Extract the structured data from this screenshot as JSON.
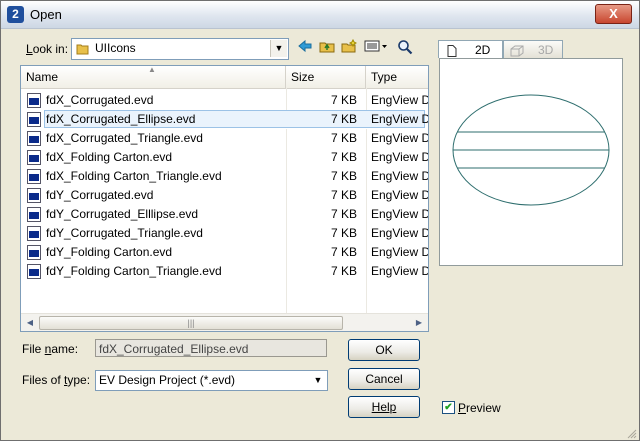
{
  "window": {
    "title": "Open",
    "close_label": "X"
  },
  "lookin": {
    "label": "Look in:",
    "value": "UIIcons"
  },
  "columns": {
    "name": "Name",
    "size": "Size",
    "type": "Type"
  },
  "files": [
    {
      "name": "fdX_Corrugated.evd",
      "size": "7 KB",
      "type": "EngView D",
      "selected": false
    },
    {
      "name": "fdX_Corrugated_Ellipse.evd",
      "size": "7 KB",
      "type": "EngView D",
      "selected": true
    },
    {
      "name": "fdX_Corrugated_Triangle.evd",
      "size": "7 KB",
      "type": "EngView D",
      "selected": false
    },
    {
      "name": "fdX_Folding Carton.evd",
      "size": "7 KB",
      "type": "EngView D",
      "selected": false
    },
    {
      "name": "fdX_Folding Carton_Triangle.evd",
      "size": "7 KB",
      "type": "EngView D",
      "selected": false
    },
    {
      "name": "fdY_Corrugated.evd",
      "size": "7 KB",
      "type": "EngView D",
      "selected": false
    },
    {
      "name": "fdY_Corrugated_Elllipse.evd",
      "size": "7 KB",
      "type": "EngView D",
      "selected": false
    },
    {
      "name": "fdY_Corrugated_Triangle.evd",
      "size": "7 KB",
      "type": "EngView D",
      "selected": false
    },
    {
      "name": "fdY_Folding Carton.evd",
      "size": "7 KB",
      "type": "EngView D",
      "selected": false
    },
    {
      "name": "fdY_Folding Carton_Triangle.evd",
      "size": "7 KB",
      "type": "EngView D",
      "selected": false
    }
  ],
  "filename": {
    "label": "File name:",
    "value": "fdX_Corrugated_Ellipse.evd"
  },
  "filetype": {
    "label": "Files of type:",
    "value": "EV Design Project (*.evd)"
  },
  "buttons": {
    "ok": "OK",
    "cancel": "Cancel",
    "help": "Help"
  },
  "tabs": {
    "tab2d": "2D",
    "tab3d": "3D"
  },
  "preview": {
    "label": "Preview",
    "checked": true
  },
  "colors": {
    "accent": "#1f4f9d",
    "file_icon": "#0a2a8a",
    "folder": "#e8c04a",
    "preview_stroke": "#2e6e6e"
  }
}
